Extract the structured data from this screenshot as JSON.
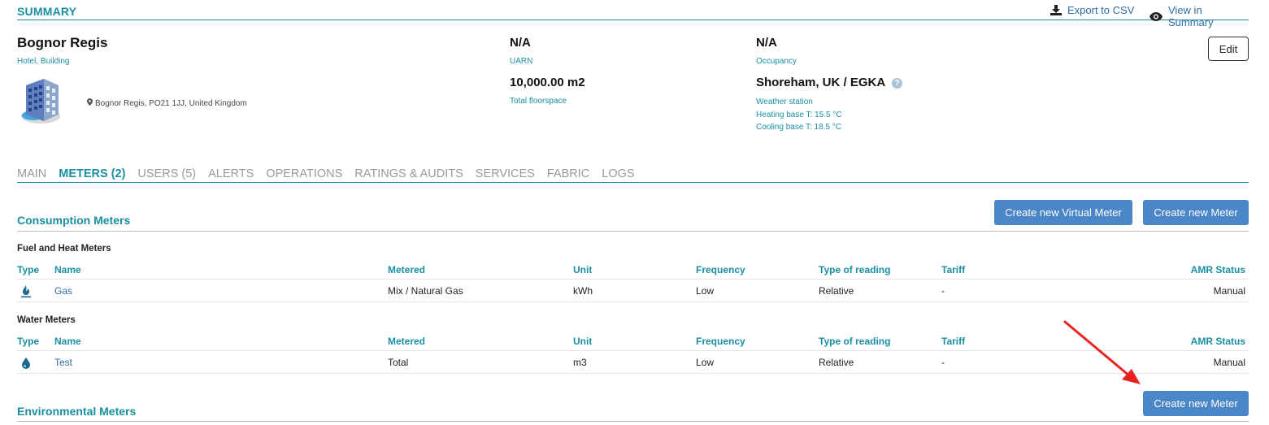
{
  "summary": {
    "title": "SUMMARY",
    "export_label": "Export to CSV",
    "view_label": "View in Summary"
  },
  "building": {
    "name": "Bognor Regis",
    "type": "Hotel, Building",
    "address": "Bognor Regis, PO21 1JJ, United Kingdom",
    "uarn_value": "N/A",
    "uarn_label": "UARN",
    "floorspace_value": "10,000.00 m2",
    "floorspace_label": "Total floorspace",
    "occupancy_value": "N/A",
    "occupancy_label": "Occupancy",
    "weather_value": "Shoreham, UK / EGKA",
    "weather_label": "Weather station",
    "heating_base": "Heating base T: 15.5 °C",
    "cooling_base": "Cooling base T: 18.5 °C",
    "edit_label": "Edit"
  },
  "tabs": [
    {
      "label": "MAIN",
      "active": false
    },
    {
      "label": "METERS (2)",
      "active": true
    },
    {
      "label": "USERS (5)",
      "active": false
    },
    {
      "label": "ALERTS",
      "active": false
    },
    {
      "label": "OPERATIONS",
      "active": false
    },
    {
      "label": "RATINGS & AUDITS",
      "active": false
    },
    {
      "label": "SERVICES",
      "active": false
    },
    {
      "label": "FABRIC",
      "active": false
    },
    {
      "label": "LOGS",
      "active": false
    }
  ],
  "consumption": {
    "title": "Consumption Meters",
    "create_virtual_label": "Create new Virtual Meter",
    "create_meter_label": "Create new Meter"
  },
  "columns": {
    "type": "Type",
    "name": "Name",
    "metered": "Metered",
    "unit": "Unit",
    "frequency": "Frequency",
    "reading": "Type of reading",
    "tariff": "Tariff",
    "amr": "AMR Status"
  },
  "fuel_meters": {
    "title": "Fuel and Heat Meters",
    "rows": [
      {
        "icon": "gas-flame-icon",
        "name": "Gas",
        "metered": "Mix / Natural Gas",
        "unit": "kWh",
        "frequency": "Low",
        "reading": "Relative",
        "tariff": "-",
        "amr": "Manual"
      }
    ]
  },
  "water_meters": {
    "title": "Water Meters",
    "rows": [
      {
        "icon": "water-drop-icon",
        "name": "Test",
        "metered": "Total",
        "unit": "m3",
        "frequency": "Low",
        "reading": "Relative",
        "tariff": "-",
        "amr": "Manual"
      }
    ]
  },
  "environmental": {
    "title": "Environmental Meters",
    "create_meter_label": "Create new Meter"
  },
  "colors": {
    "accent": "#1a8fa3",
    "link": "#2e6da4",
    "button": "#4a86c8",
    "annotation": "#e8231f"
  }
}
